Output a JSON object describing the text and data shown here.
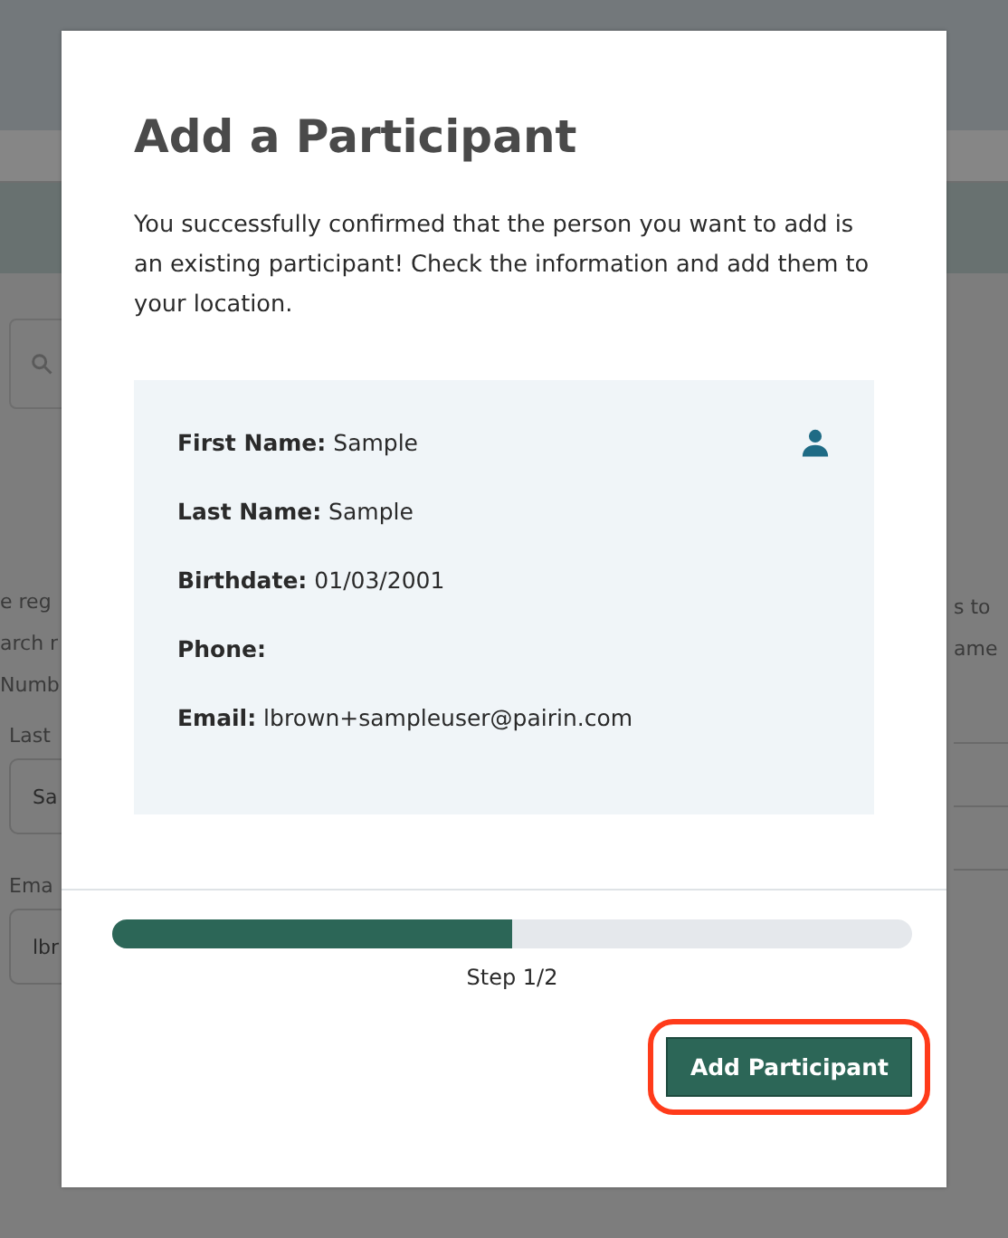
{
  "background": {
    "left_lines": [
      "e reg",
      "arch r",
      "Numb"
    ],
    "right_lines": [
      "s to",
      "ame"
    ],
    "fields": [
      {
        "label": "Last",
        "value": "Sa"
      },
      {
        "label": "Ema",
        "value": "lbr"
      }
    ]
  },
  "dialog": {
    "title": "Add a Participant",
    "message": "You successfully confirmed that the person you want to add is an existing participant! Check the information and add them to your location.",
    "details": [
      {
        "label": "First Name:",
        "value": "Sample"
      },
      {
        "label": "Last Name:",
        "value": "Sample"
      },
      {
        "label": "Birthdate:",
        "value": "01/03/2001"
      },
      {
        "label": "Phone:"
      },
      {
        "label": "Email:",
        "value": "lbrown+sampleuser@pairin.com"
      }
    ],
    "progress": {
      "level": 0.5,
      "label": "Step 1/2"
    },
    "button": {
      "label": "Add Participant",
      "highlighted": true
    }
  }
}
